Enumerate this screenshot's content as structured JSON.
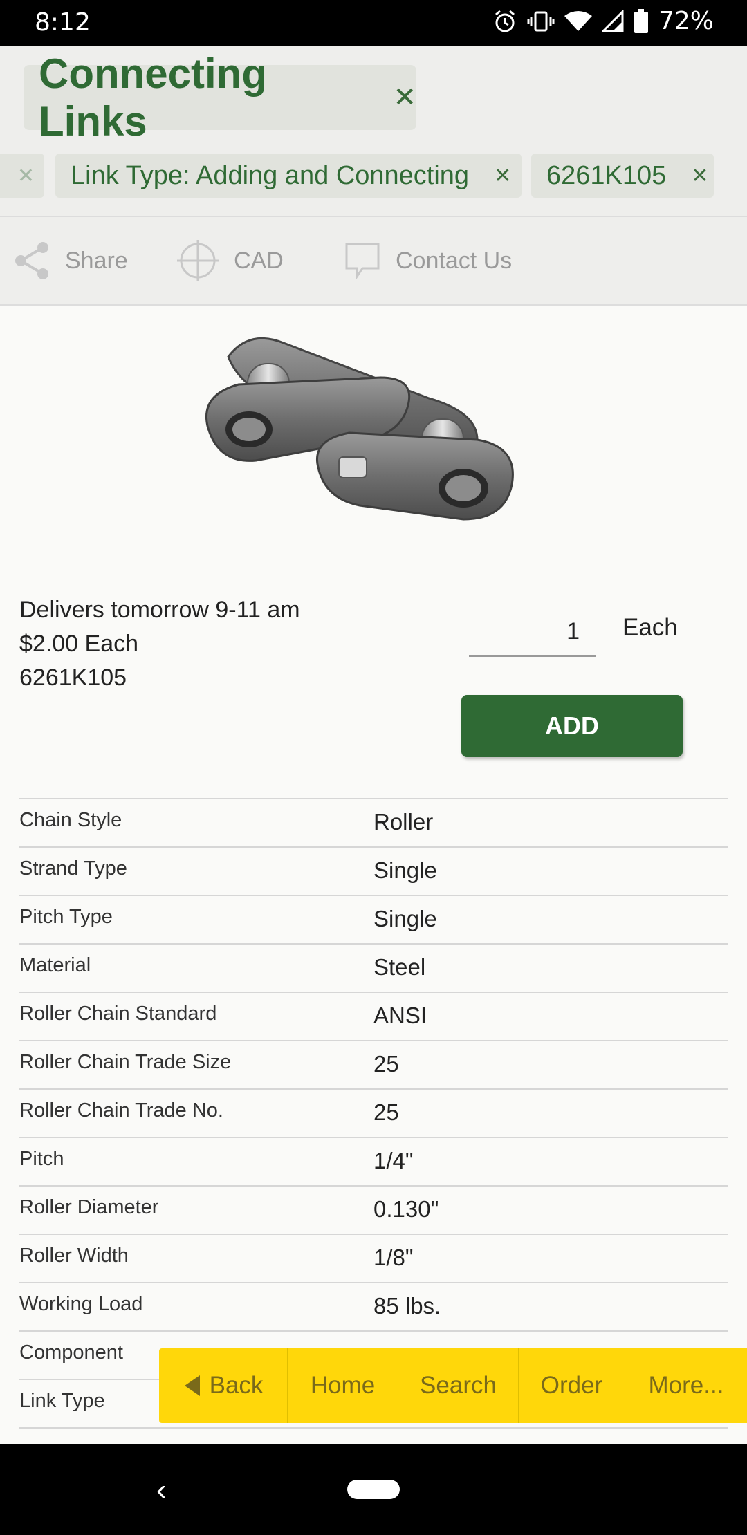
{
  "status": {
    "time": "8:12",
    "battery": "72%"
  },
  "header": {
    "title": "Connecting Links",
    "filters": [
      {
        "label": "Link Type: Adding and Connecting"
      },
      {
        "label": "6261K105"
      }
    ]
  },
  "actions": {
    "share": "Share",
    "cad": "CAD",
    "contact": "Contact Us"
  },
  "product": {
    "delivery": "Delivers tomorrow 9-11 am",
    "price": "$2.00 Each",
    "part_number": "6261K105",
    "quantity": "1",
    "unit": "Each",
    "add_label": "ADD"
  },
  "specs": [
    {
      "label": "Chain Style",
      "value": "Roller"
    },
    {
      "label": "Strand Type",
      "value": "Single"
    },
    {
      "label": "Pitch Type",
      "value": "Single"
    },
    {
      "label": "Material",
      "value": "Steel"
    },
    {
      "label": "Roller Chain Standard",
      "value": "ANSI"
    },
    {
      "label": "Roller Chain Trade Size",
      "value": "25"
    },
    {
      "label": "Roller Chain Trade No.",
      "value": "25"
    },
    {
      "label": "Pitch",
      "value": "1/4\""
    },
    {
      "label": "Roller Diameter",
      "value": "0.130\""
    },
    {
      "label": "Roller Width",
      "value": "1/8\""
    },
    {
      "label": "Working Load",
      "value": "85 lbs."
    },
    {
      "label": "Component",
      "value": ""
    },
    {
      "label": "Link Type",
      "value": ""
    }
  ],
  "toolbar": {
    "back": "Back",
    "home": "Home",
    "search": "Search",
    "order": "Order",
    "more": "More..."
  }
}
